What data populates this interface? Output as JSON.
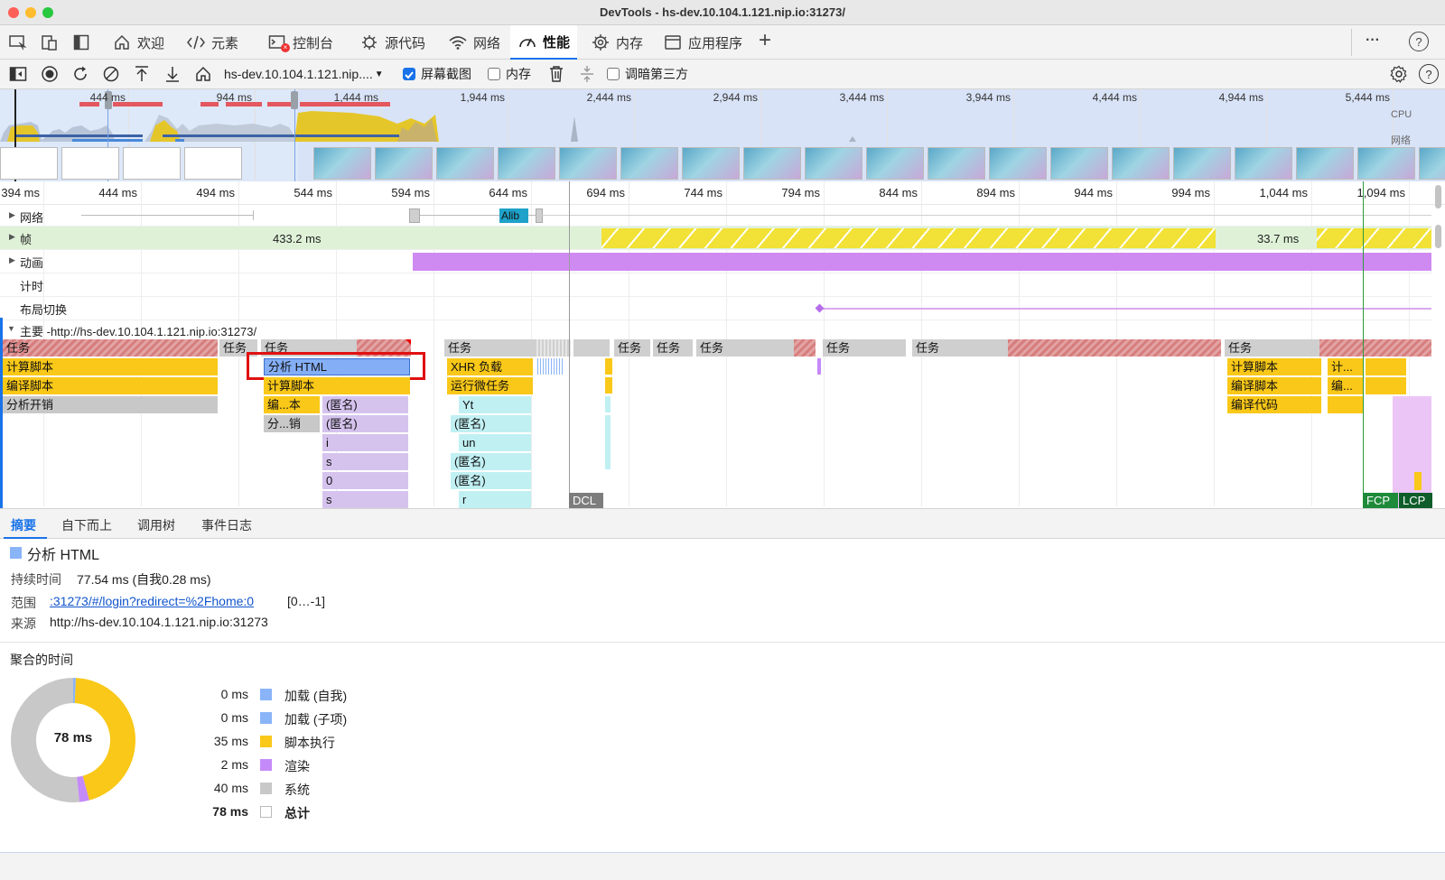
{
  "window": {
    "title": "DevTools - hs-dev.10.104.1.121.nip.io:31273/"
  },
  "tabs": [
    {
      "label": "欢迎",
      "icon": "home-icon"
    },
    {
      "label": "元素",
      "icon": "code-icon"
    },
    {
      "label": "控制台",
      "icon": "console-icon",
      "error_badge": "×"
    },
    {
      "label": "源代码",
      "icon": "bug-icon"
    },
    {
      "label": "网络",
      "icon": "wifi-icon"
    },
    {
      "label": "性能",
      "icon": "gauge-icon",
      "active": true
    },
    {
      "label": "内存",
      "icon": "chip-icon"
    },
    {
      "label": "应用程序",
      "icon": "window-icon"
    }
  ],
  "tabbar": {
    "add_label": "+",
    "more_label": "···",
    "help_label": "?"
  },
  "toolbar": {
    "url": "hs-dev.10.104.1.121.nip....",
    "screenshot_label": "屏幕截图",
    "screenshot_checked": true,
    "memory_label": "内存",
    "memory_checked": false,
    "dim_third_party_label": "调暗第三方",
    "dim_third_party_checked": false
  },
  "overview": {
    "ticks": [
      "444 ms",
      "944 ms",
      "1,444 ms",
      "1,944 ms",
      "2,444 ms",
      "2,944 ms",
      "3,444 ms",
      "3,944 ms",
      "4,444 ms",
      "4,944 ms",
      "5,444 ms"
    ],
    "cpu_label": "CPU",
    "net_label": "网络"
  },
  "ruler": {
    "ticks": [
      "394 ms",
      "444 ms",
      "494 ms",
      "544 ms",
      "594 ms",
      "644 ms",
      "694 ms",
      "744 ms",
      "794 ms",
      "844 ms",
      "894 ms",
      "944 ms",
      "994 ms",
      "1,044 ms",
      "1,094 ms"
    ]
  },
  "tracks": {
    "network": {
      "label": "网络",
      "item": "Alib"
    },
    "frames": {
      "label": "帧",
      "frame1": "433.2 ms",
      "frame2": "33.7 ms"
    },
    "animations": {
      "label": "动画"
    },
    "timings": {
      "label": "计时"
    },
    "layout_shifts": {
      "label": "布局切换"
    },
    "main": {
      "label": "主要 -http://hs-dev.10.104.1.121.nip.io:31273/"
    }
  },
  "flame": {
    "task": "任务",
    "eval_script": "计算脚本",
    "compile_script": "编译脚本",
    "parse_overhead": "分析开销",
    "parse_html": "分析 HTML",
    "compile_short": "编...本",
    "parse_short": "分...销",
    "anonymous": "(匿名)",
    "i": "i",
    "s": "s",
    "zero": "0",
    "xhr_load": "XHR 负载",
    "microtasks": "运行微任务",
    "yt": "Yt",
    "un": "un",
    "r": "r",
    "compile_code": "编译代码",
    "ji": "计...",
    "bian": "编...",
    "dcl": "DCL",
    "fcp": "FCP",
    "lcp": "LCP"
  },
  "bottom_tabs": [
    "摘要",
    "自下而上",
    "调用树",
    "事件日志"
  ],
  "summary": {
    "title": "分析 HTML",
    "duration_label": "持续时间",
    "duration_value": "77.54 ms (自我0.28 ms)",
    "range_label": "范围",
    "range_link": ":31273/#/login?redirect=%2Fhome:0",
    "range_suffix": "[0…-1]",
    "source_label": "来源",
    "source_value": "http://hs-dev.10.104.1.121.nip.io:31273",
    "aggregated_label": "聚合的时间",
    "total_center": "78 ms",
    "legend": [
      {
        "value": "0 ms",
        "label": "加载 (自我)",
        "color": "#8ab4f8"
      },
      {
        "value": "0 ms",
        "label": "加载 (子项)",
        "color": "#8ab4f8"
      },
      {
        "value": "35 ms",
        "label": "脚本执行",
        "color": "#f9c818"
      },
      {
        "value": "2 ms",
        "label": "渲染",
        "color": "#c58af9"
      },
      {
        "value": "40 ms",
        "label": "系统",
        "color": "#c8c8c8"
      },
      {
        "value": "78 ms",
        "label": "总计",
        "color": "#ffffff",
        "bold": true
      }
    ]
  },
  "donut": {
    "scripting": 35,
    "rendering": 2,
    "system": 40,
    "loading": 0.54
  }
}
